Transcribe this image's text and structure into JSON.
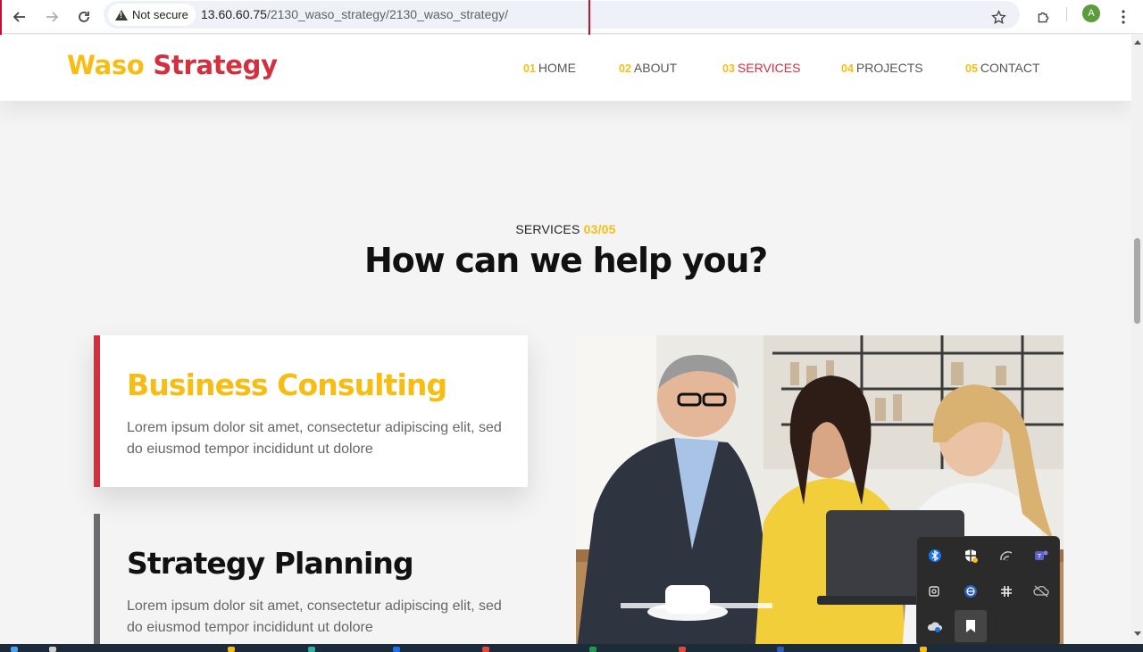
{
  "browser": {
    "security_label": "Not secure",
    "url_host": "13.60.60.75",
    "url_path": "/2130_waso_strategy/2130_waso_strategy/",
    "profile_initial": "A"
  },
  "site": {
    "logo_part1": "Waso",
    "logo_part2": "Strategy",
    "nav": [
      {
        "num": "01",
        "label": "HOME",
        "active": false
      },
      {
        "num": "02",
        "label": "ABOUT",
        "active": false
      },
      {
        "num": "03",
        "label": "SERVICES",
        "active": true
      },
      {
        "num": "04",
        "label": "PROJECTS",
        "active": false
      },
      {
        "num": "05",
        "label": "CONTACT",
        "active": false
      }
    ]
  },
  "section": {
    "eyebrow_label": "SERVICES",
    "eyebrow_count": "03/05",
    "heading": "How can we help you?"
  },
  "services": [
    {
      "title": "Business Consulting",
      "text": "Lorem ipsum dolor sit amet, consectetur adipiscing elit, sed do eiusmod tempor incididunt ut dolore"
    },
    {
      "title": "Strategy Planning",
      "text": "Lorem ipsum dolor sit amet, consectetur adipiscing elit, sed do eiusmod tempor incididunt ut dolore"
    }
  ],
  "colors": {
    "brand_yellow": "#f7bd13",
    "brand_red": "#d32f3f",
    "text_dark": "#111111",
    "text_muted": "#666666",
    "page_bg": "#f4f4f4"
  },
  "tray_icons": [
    "bluetooth-icon",
    "security-shield-icon",
    "wifi-icon",
    "teams-icon",
    "camera-icon",
    "vpn-globe-icon",
    "slack-icon",
    "cloud-off-icon",
    "weather-icon",
    "snip-icon"
  ]
}
